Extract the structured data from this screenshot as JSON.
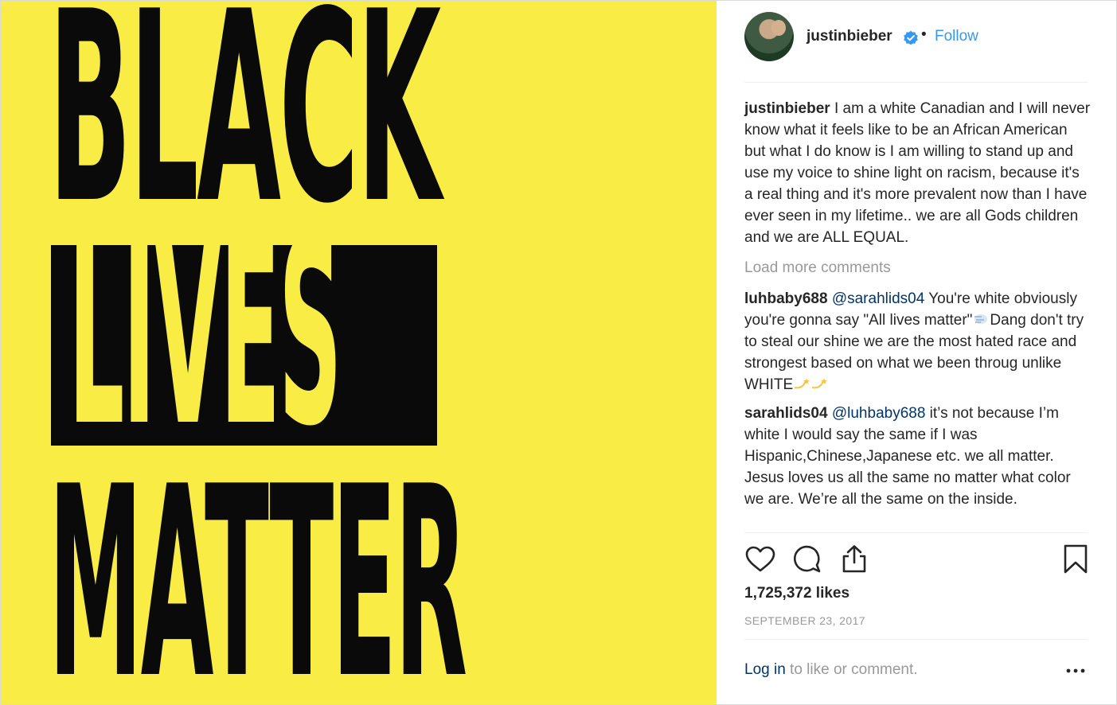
{
  "image": {
    "line1": "BLACK",
    "line2": "LIVES",
    "line3": "MATTER",
    "colors": {
      "background": "#f8ec45",
      "ink": "#0a0a0a"
    }
  },
  "header": {
    "username": "justinbieber",
    "separator": "•",
    "follow_label": "Follow",
    "verified_icon": "verified-badge-icon"
  },
  "caption": {
    "user": "justinbieber",
    "text": " I am a white Canadian and I will never know what it feels like to be an African American but what I do know is I am willing to stand up and use my voice to shine light on racism, because it's a real thing and it's more prevalent now than I have ever seen in my lifetime.. we are all Gods children and we are ALL EQUAL."
  },
  "load_more": "Load more comments",
  "comments": [
    {
      "user": "luhbaby688",
      "mention": "@sarahlids04",
      "text_before_emoji": " You're white obviously you're gonna say \"All lives matter\"",
      "text_after_emoji": "Dang don't try to steal our shine we are the most hated race and strongest based on what we been throug unlike WHITE"
    },
    {
      "user": "sarahlids04",
      "mention": "@luhbaby688",
      "text": " it’s not because I’m white I would say the same if I was Hispanic,Chinese,Japanese etc. we all matter. Jesus loves us all the same no matter what color we are. We’re all the same on the inside."
    }
  ],
  "actions": {
    "icons": [
      "heart-icon",
      "comment-icon",
      "share-icon",
      "bookmark-icon"
    ]
  },
  "likes": "1,725,372 likes",
  "date": "SEPTEMBER 23, 2017",
  "footer": {
    "login_label": "Log in",
    "login_suffix": " to like or comment.",
    "more_icon": "more-options-icon"
  },
  "colors": {
    "link_blue": "#3897f0",
    "mention_blue": "#003569",
    "muted_gray": "#999999"
  }
}
